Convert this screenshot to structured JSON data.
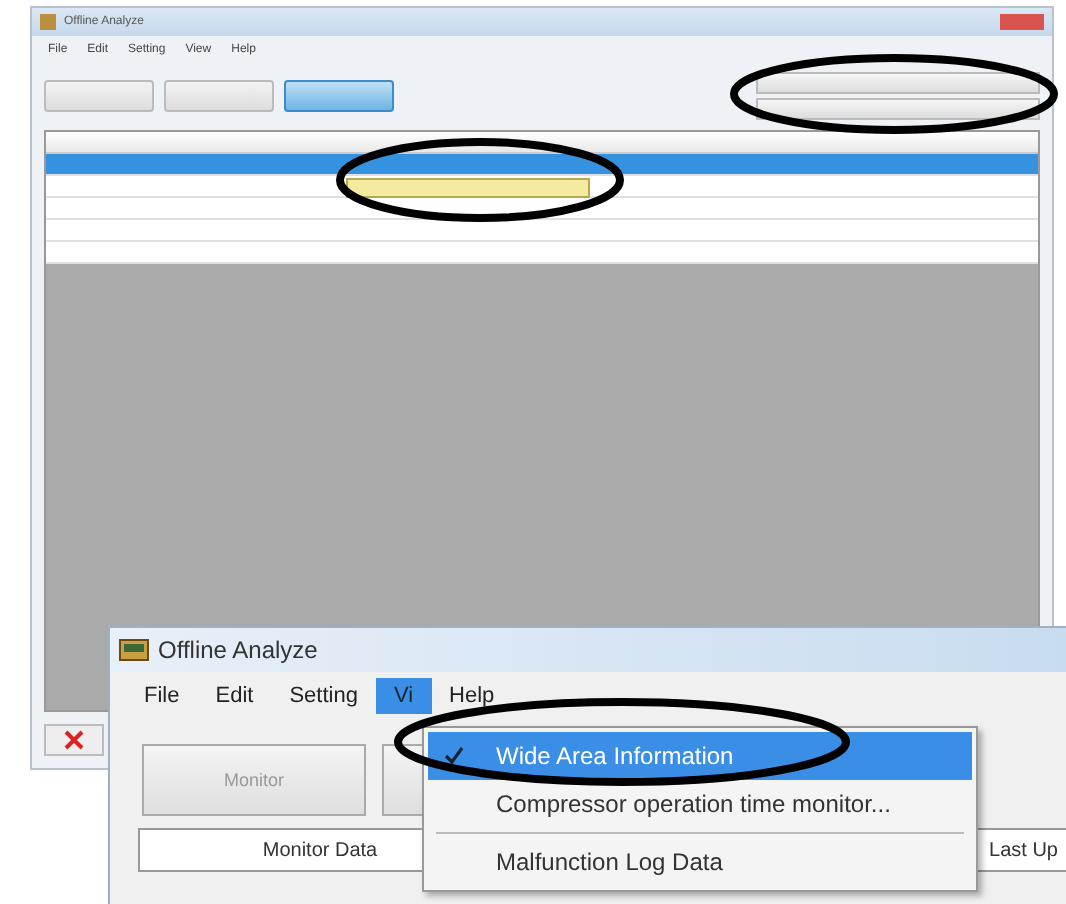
{
  "main_window": {
    "title": "Offline Analyze",
    "menu": [
      "File",
      "Edit",
      "Setting",
      "View",
      "Help"
    ],
    "toolbar_buttons": [
      {
        "selected": false
      },
      {
        "selected": false
      },
      {
        "selected": true
      }
    ],
    "table": {
      "rows": [
        {
          "selected": true,
          "tooltip": false
        },
        {
          "selected": false,
          "tooltip": true
        },
        {
          "selected": false,
          "tooltip": false
        },
        {
          "selected": false,
          "tooltip": false
        },
        {
          "selected": false,
          "tooltip": false
        }
      ]
    }
  },
  "inset_window": {
    "title": "Offline Analyze",
    "menu": [
      {
        "label": "File",
        "selected": false
      },
      {
        "label": "Edit",
        "selected": false
      },
      {
        "label": "Setting",
        "selected": false
      },
      {
        "label": "Vi",
        "selected": true
      },
      {
        "label": "Help",
        "selected": false
      }
    ],
    "dropdown": [
      {
        "label": "Wide Area Information",
        "checked": true,
        "selected": true
      },
      {
        "label": "Compressor operation time monitor...",
        "checked": false,
        "selected": false
      },
      {
        "label": "Malfunction Log Data",
        "checked": false,
        "selected": false
      }
    ],
    "button": "Monitor",
    "columns": [
      "Monitor Data",
      "Last Up"
    ]
  }
}
